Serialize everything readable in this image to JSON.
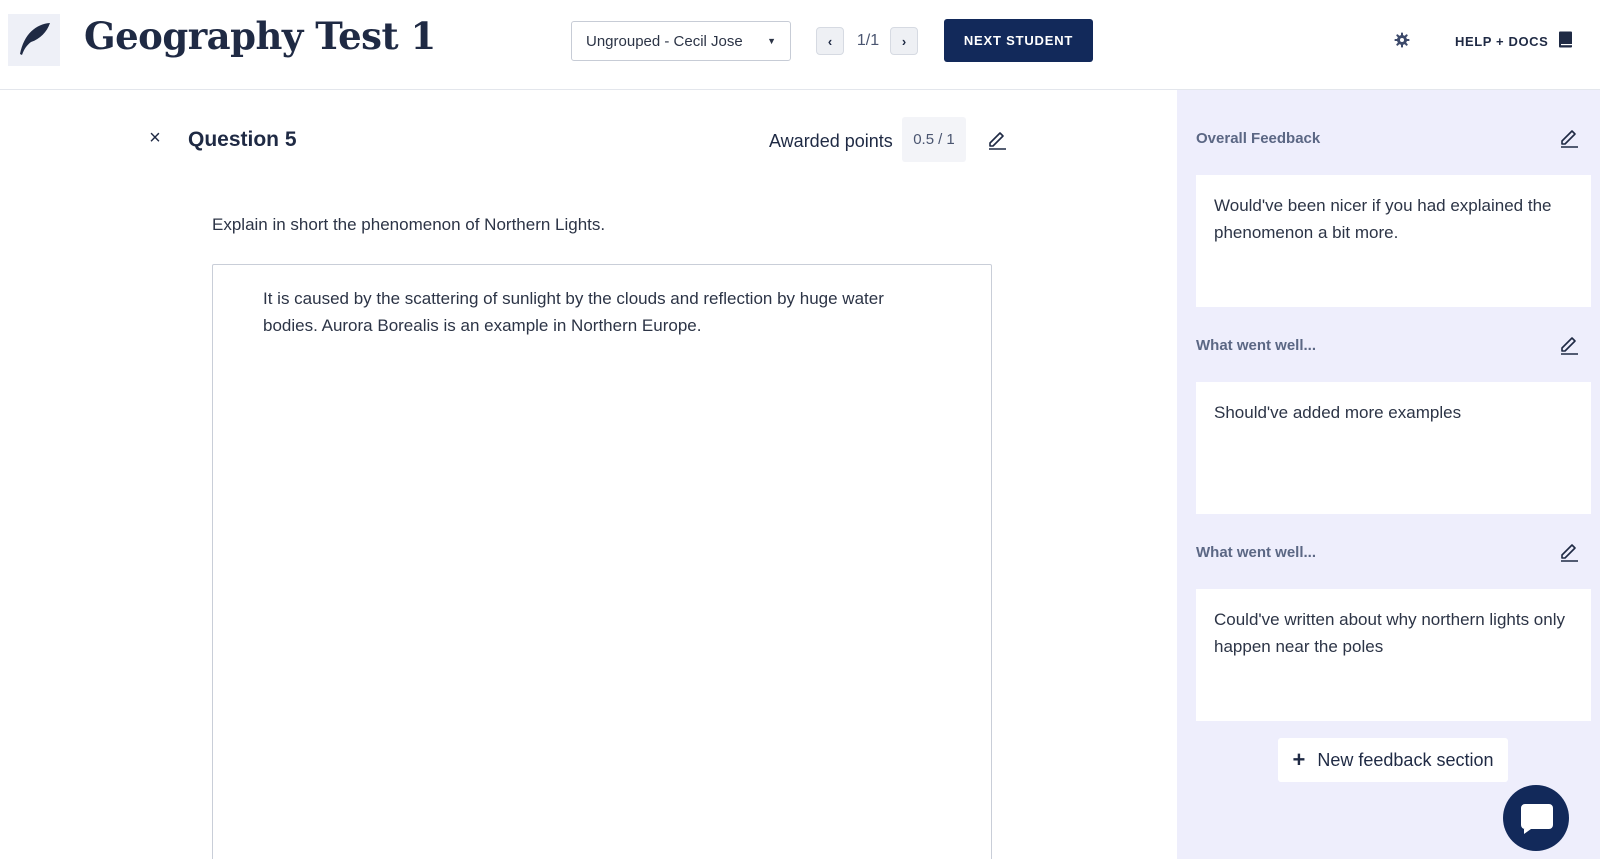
{
  "header": {
    "app_title": "Geography Test 1",
    "student_select": "Ungrouped - Cecil Jose",
    "pager": {
      "prev": "‹",
      "count": "1/1",
      "next": "›"
    },
    "next_student_label": "NEXT STUDENT",
    "help_label": "HELP + DOCS",
    "icons": [
      "feather-logo-icon",
      "caret-down-icon",
      "gear-icon",
      "book-icon"
    ]
  },
  "question": {
    "close": "×",
    "title": "Question 5",
    "awarded_label": "Awarded points",
    "awarded": "0.5",
    "max": "/ 1",
    "prompt": "Explain in short the phenomenon of Northern Lights.",
    "answer": "It is caused by the scattering of sunlight by the clouds and reflection by huge water bodies. Aurora Borealis is an example in Northern Europe."
  },
  "feedback": {
    "sections": [
      {
        "heading": "Overall Feedback",
        "text": "Would've been nicer if you had explained the phenomenon a bit more."
      },
      {
        "heading": "What went well...",
        "text": "Should've added more examples"
      },
      {
        "heading": "What went well...",
        "text": "Could've written about why northern lights only happen near the poles"
      }
    ],
    "new_section_label": "New feedback section",
    "new_section_icon": "+"
  },
  "colors": {
    "navy": "#12295a",
    "panel_bg": "#eeeefc",
    "text": "#1f2a44",
    "muted": "#5b6784"
  }
}
